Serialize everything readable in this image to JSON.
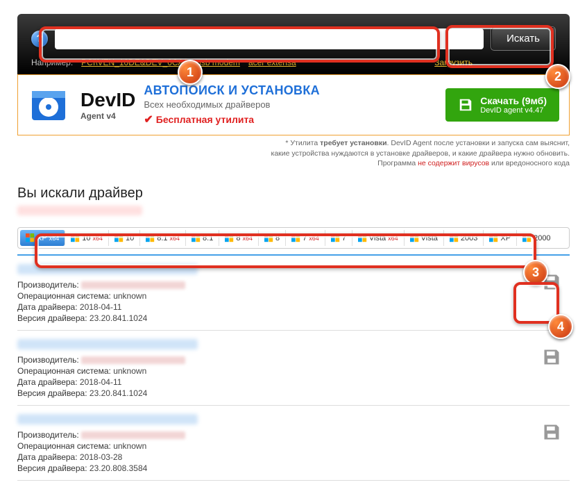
{
  "header": {
    "search_value": "",
    "search_button": "Искать",
    "example_label": "Например:",
    "examples": [
      "PCI\\VEN_10DE&DEV_0CA3",
      "usb modem",
      "acer extensa"
    ],
    "upload_link": "Загрузить"
  },
  "promo": {
    "logo_text": "DevID",
    "logo_sub": "Agent v4",
    "headline": "АВТОПОИСК И УСТАНОВКА",
    "subline": "Всех необходимых драйверов",
    "free_utility": "Бесплатная утилита",
    "download_label": "Скачать (9мб)",
    "download_sub": "DevID agent v4.47"
  },
  "disclaimer": {
    "l1a": "* Утилита ",
    "l1b": "требует установки",
    "l1c": ". DevID Agent после установки и запуска сам выяснит,",
    "l2": "какие устройства нуждаются в установке драйверов, и какие драйвера нужно обновить.",
    "l3a": "Программа ",
    "l3b": "не содержит вирусов",
    "l3c": " или вредоносного кода"
  },
  "search_title": "Вы искали драйвер",
  "os_tabs": [
    {
      "label": "XP",
      "sup": "x64",
      "sel": true
    },
    {
      "label": "10",
      "sup": "x64"
    },
    {
      "label": "10",
      "sup": ""
    },
    {
      "label": "8.1",
      "sup": "x64"
    },
    {
      "label": "8.1",
      "sup": ""
    },
    {
      "label": "8",
      "sup": "x64"
    },
    {
      "label": "8",
      "sup": ""
    },
    {
      "label": "7",
      "sup": "x64"
    },
    {
      "label": "7",
      "sup": ""
    },
    {
      "label": "Vista",
      "sup": "x64"
    },
    {
      "label": "Vista",
      "sup": ""
    },
    {
      "label": "2003",
      "sup": ""
    },
    {
      "label": "XP",
      "sup": ""
    },
    {
      "label": "2000",
      "sup": ""
    }
  ],
  "labels": {
    "manufacturer": "Производитель:",
    "os": "Операционная система:",
    "date": "Дата драйвера:",
    "version": "Версия драйвера:"
  },
  "results": [
    {
      "os": "unknown",
      "date": "2018-04-11",
      "version": "23.20.841.1024"
    },
    {
      "os": "unknown",
      "date": "2018-04-11",
      "version": "23.20.841.1024"
    },
    {
      "os": "unknown",
      "date": "2018-03-28",
      "version": "23.20.808.3584"
    }
  ],
  "callouts": {
    "1": "1",
    "2": "2",
    "3": "3",
    "4": "4"
  }
}
